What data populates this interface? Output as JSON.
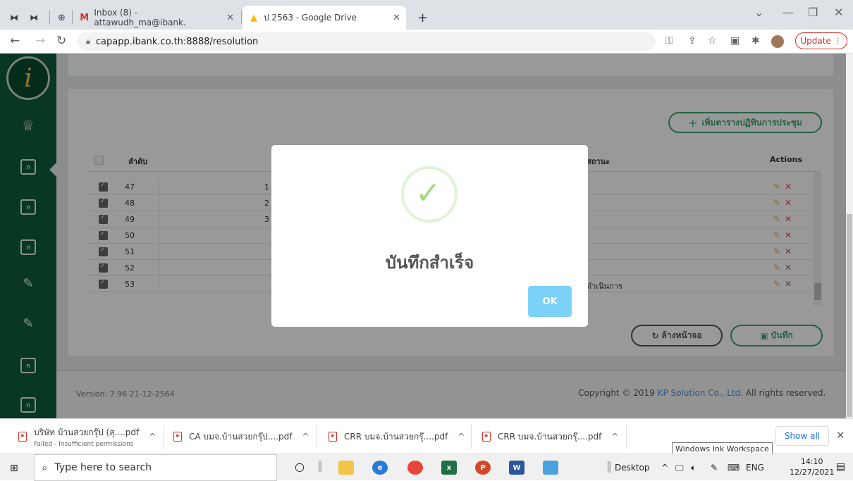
{
  "browser": {
    "tabs": [
      {
        "label": "Inbox (8) - attawudh_ma@ibank.",
        "icon": "gmail-icon"
      },
      {
        "label": "ป 2563 - Google Drive",
        "icon": "google-drive-icon"
      }
    ],
    "url": "capapp.ibank.co.th:8888/resolution",
    "update_label": "Update"
  },
  "page": {
    "add_button_label": "เพิ่มตารางปฏิทินการประชุม",
    "table": {
      "columns": {
        "order": "ลำดับ",
        "status": "สถานะ",
        "actions": "Actions"
      },
      "rows": [
        {
          "num": "47",
          "col3": "1",
          "status": ""
        },
        {
          "num": "48",
          "col3": "2",
          "status": ""
        },
        {
          "num": "49",
          "col3": "3",
          "status": ""
        },
        {
          "num": "50",
          "col3": "",
          "status": ""
        },
        {
          "num": "51",
          "col3": "",
          "status": ""
        },
        {
          "num": "52",
          "col3": "",
          "status": ""
        },
        {
          "num": "53",
          "col3": "",
          "status": "ดำเนินการ"
        }
      ]
    },
    "clear_button_label": "ล้างหน้าจอ",
    "save_button_label": "บันทึก",
    "footer": {
      "version": "Version: 7.96 21-12-2564",
      "copyright_prefix": "Copyright © 2019 ",
      "company": "KP Solution Co., Ltd.",
      "copyright_suffix": " All rights reserved."
    }
  },
  "modal": {
    "message": "บันทึกสำเร็จ",
    "ok_label": "OK"
  },
  "downloads": {
    "items": [
      {
        "name": "บริษัท บ้านสวยกรุ๊ป (สุ....pdf",
        "sub": "Failed - Insufficient permissions"
      },
      {
        "name": "CA บมจ.บ้านสวยกรุ๊ป....pdf",
        "sub": ""
      },
      {
        "name": "CRR บมจ.บ้านสวยกรุ๊....pdf",
        "sub": ""
      },
      {
        "name": "CRR บมจ.บ้านสวยกรุ๊....pdf",
        "sub": ""
      }
    ],
    "show_all": "Show all",
    "tooltip": "Windows Ink Workspace"
  },
  "taskbar": {
    "search_placeholder": "Type here to search",
    "desktop_label": "Desktop",
    "lang": "ENG",
    "time": "14:10",
    "date": "12/27/2021"
  }
}
